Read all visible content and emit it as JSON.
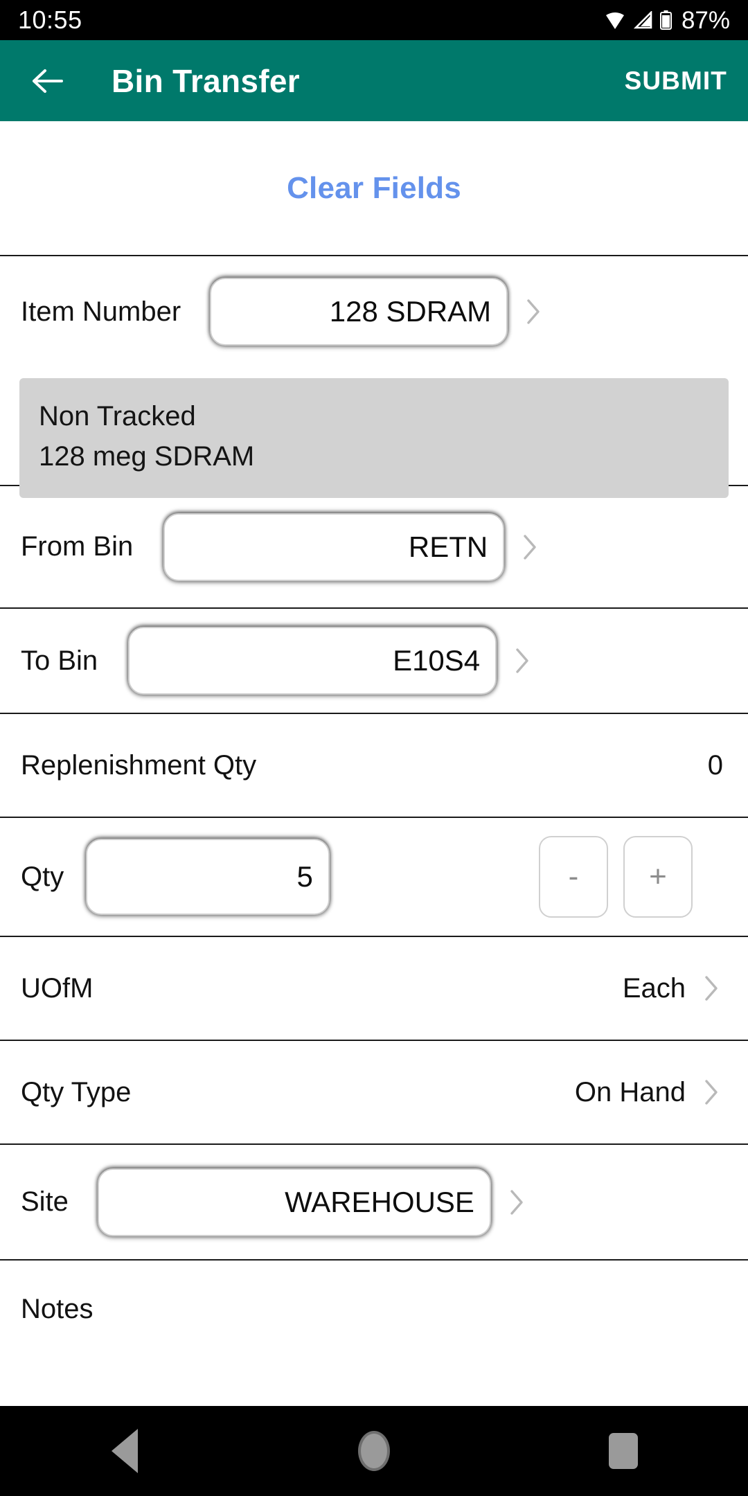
{
  "status_bar": {
    "time": "10:55",
    "battery_percent": "87%",
    "icons": [
      "wifi-icon",
      "signal-icon",
      "battery-icon"
    ]
  },
  "app_bar": {
    "back_icon": "back-arrow-icon",
    "title": "Bin Transfer",
    "submit_label": "SUBMIT",
    "background_color": "#00796B"
  },
  "content": {
    "clear_fields_label": "Clear Fields",
    "clear_fields_color": "#6492EC",
    "item_number": {
      "label": "Item Number",
      "value": "128 SDRAM",
      "chevron": ">"
    },
    "item_info": {
      "tracking": "Non Tracked",
      "description": "128 meg SDRAM",
      "background_color": "#d2d2d2"
    },
    "from_bin": {
      "label": "From Bin",
      "value": "RETN",
      "chevron": ">"
    },
    "to_bin": {
      "label": "To Bin",
      "value": "E10S4",
      "chevron": ">"
    },
    "replenishment_qty": {
      "label": "Replenishment Qty",
      "value": "0"
    },
    "qty": {
      "label": "Qty",
      "value": "5",
      "decrement_label": "-",
      "increment_label": "+"
    },
    "uofm": {
      "label": "UOfM",
      "value": "Each",
      "chevron": ">"
    },
    "qty_type": {
      "label": "Qty Type",
      "value": "On Hand",
      "chevron": ">"
    },
    "site": {
      "label": "Site",
      "value": "WAREHOUSE",
      "chevron": ">"
    },
    "notes": {
      "label": "Notes",
      "value": ""
    }
  },
  "nav_bar": {
    "back_icon": "nav-back-icon",
    "home_icon": "nav-home-icon",
    "recents_icon": "nav-recents-icon"
  }
}
